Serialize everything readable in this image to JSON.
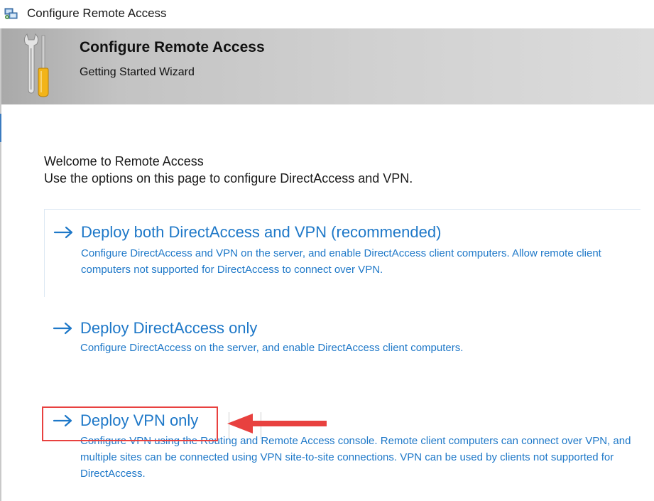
{
  "window": {
    "title": "Configure Remote Access",
    "icon": "remote-access-app-icon"
  },
  "banner": {
    "title": "Configure Remote Access",
    "subtitle": "Getting Started Wizard",
    "icon": "wrench-screwdriver-icon"
  },
  "content": {
    "welcome": "Welcome to Remote Access",
    "intro": "Use the options on this page to configure DirectAccess and VPN."
  },
  "options": [
    {
      "title": "Deploy both DirectAccess and VPN (recommended)",
      "description": "Configure DirectAccess and VPN on the server, and enable DirectAccess client computers. Allow remote client computers not supported for DirectAccess to connect over VPN.",
      "icon": "arrow-right-icon"
    },
    {
      "title": "Deploy DirectAccess only",
      "description": "Configure DirectAccess on the server, and enable DirectAccess client computers.",
      "icon": "arrow-right-icon"
    },
    {
      "title": "Deploy VPN only",
      "description": "Configure VPN using the Routing and Remote Access console. Remote client computers can connect over VPN, and multiple sites can be connected using VPN site-to-site connections. VPN can be used by clients not supported for DirectAccess.",
      "icon": "arrow-right-icon"
    }
  ],
  "annotation": {
    "highlight_color": "#e8413f",
    "highlighted_option": "Deploy VPN only"
  },
  "colors": {
    "link": "#1e78c8",
    "text": "#1a1a1a"
  }
}
